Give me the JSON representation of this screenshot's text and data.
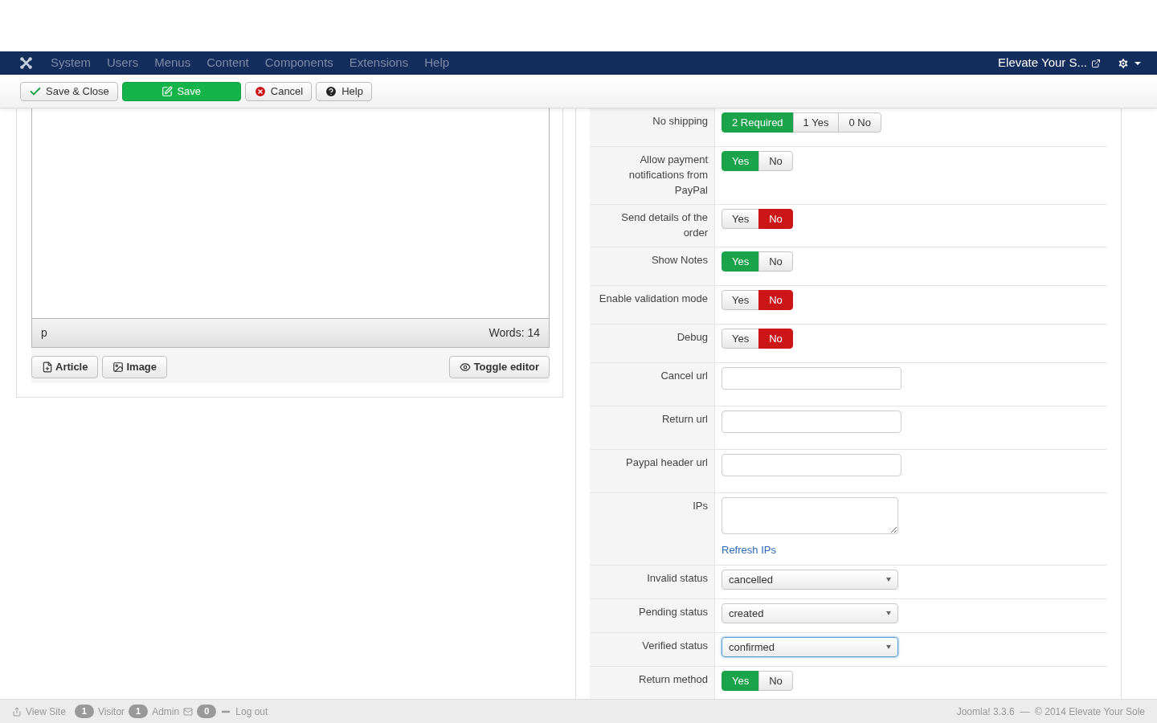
{
  "menu": [
    "System",
    "Users",
    "Menus",
    "Content",
    "Components",
    "Extensions",
    "Help"
  ],
  "site_link": "Elevate Your S...",
  "toolbar": [
    {
      "label": "Save & Close",
      "kind": "save-close"
    },
    {
      "label": "Save",
      "kind": "save"
    },
    {
      "label": "Cancel",
      "kind": "cancel"
    },
    {
      "label": "Help",
      "kind": "help"
    }
  ],
  "editor": {
    "path": "p",
    "word_count": "Words: 14",
    "buttons": [
      {
        "label": "Article",
        "kind": "article"
      },
      {
        "label": "Image",
        "kind": "image"
      }
    ],
    "toggle": "Toggle editor"
  },
  "fields": [
    {
      "label": "No shipping",
      "kind": "radio",
      "options": [
        {
          "label": "2 Required",
          "selected": true,
          "color": "#1aa34a"
        },
        {
          "label": "1 Yes",
          "selected": false
        },
        {
          "label": "0 No",
          "selected": false
        }
      ]
    },
    {
      "label": "Allow payment notifications from PayPal",
      "kind": "radio",
      "options": [
        {
          "label": "Yes",
          "selected": true,
          "color": "#1aa34a"
        },
        {
          "label": "No",
          "selected": false
        }
      ]
    },
    {
      "label": "Send details of the order",
      "kind": "radio",
      "options": [
        {
          "label": "Yes",
          "selected": false
        },
        {
          "label": "No",
          "selected": true,
          "color": "#cc1517"
        }
      ]
    },
    {
      "label": "Show Notes",
      "kind": "radio",
      "options": [
        {
          "label": "Yes",
          "selected": true,
          "color": "#1aa34a"
        },
        {
          "label": "No",
          "selected": false
        }
      ]
    },
    {
      "label": "Enable validation mode",
      "kind": "radio",
      "options": [
        {
          "label": "Yes",
          "selected": false
        },
        {
          "label": "No",
          "selected": true,
          "color": "#cc1517"
        }
      ]
    },
    {
      "label": "Debug",
      "kind": "radio",
      "options": [
        {
          "label": "Yes",
          "selected": false
        },
        {
          "label": "No",
          "selected": true,
          "color": "#cc1517"
        }
      ]
    },
    {
      "label": "Cancel url",
      "kind": "text"
    },
    {
      "label": "Return url",
      "kind": "text"
    },
    {
      "label": "Paypal header url",
      "kind": "text"
    },
    {
      "label": "IPs",
      "kind": "textarea",
      "link": "Refresh IPs"
    },
    {
      "label": "Invalid status",
      "kind": "select",
      "value": "cancelled",
      "focused": false
    },
    {
      "label": "Pending status",
      "kind": "select",
      "value": "created",
      "focused": false
    },
    {
      "label": "Verified status",
      "kind": "select",
      "value": "confirmed",
      "focused": true
    },
    {
      "label": "Return method",
      "kind": "radio",
      "options": [
        {
          "label": "Yes",
          "selected": true,
          "color": "#1aa34a"
        },
        {
          "label": "No",
          "selected": false
        }
      ]
    }
  ],
  "footer": {
    "view_site": "View Site",
    "visitors": "1",
    "visitor_label": "Visitor",
    "admins": "1",
    "admin_label": "Admin",
    "messages": "0",
    "logout": "Log out",
    "version": "Joomla! 3.3.6  —  © 2014 Elevate Your Sole"
  }
}
